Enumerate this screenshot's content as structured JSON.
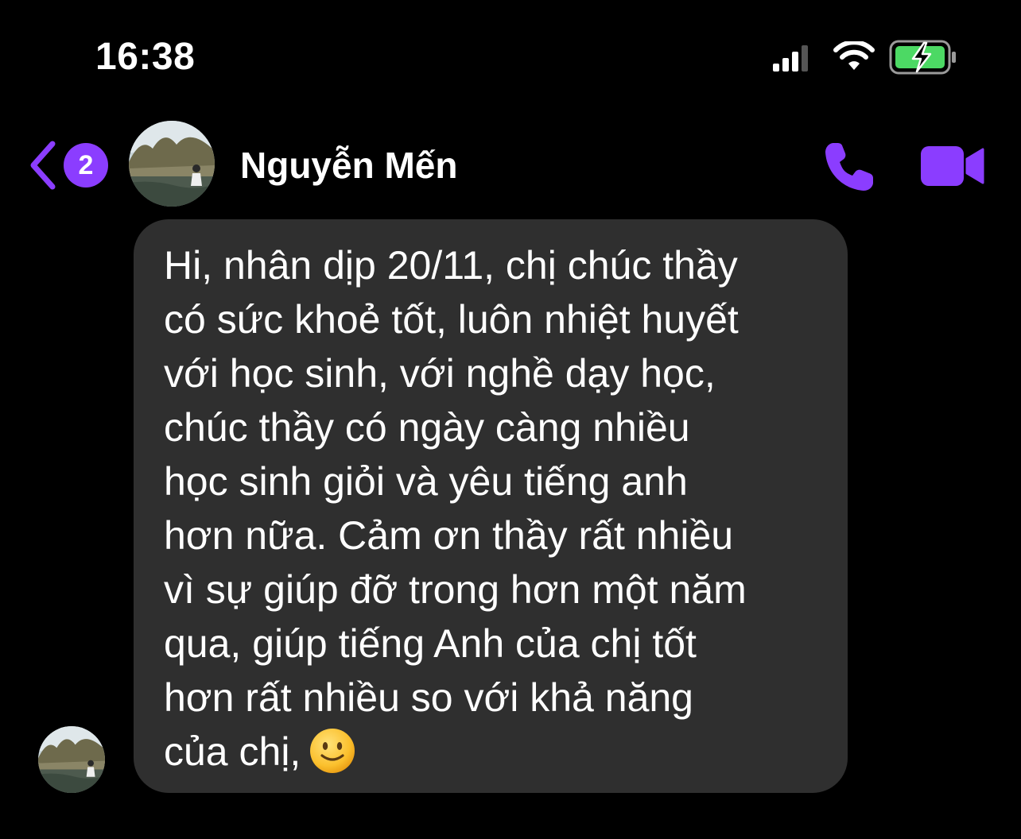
{
  "status_bar": {
    "time": "16:38",
    "signal_icon": "cellular-signal-icon",
    "wifi_icon": "wifi-icon",
    "battery_icon": "battery-charging-icon"
  },
  "header": {
    "back_icon": "chevron-left-icon",
    "back_badge": "2",
    "contact_name": "Nguyễn Mến",
    "call_icon": "phone-icon",
    "video_icon": "video-camera-icon"
  },
  "message": {
    "lines": [
      "Hi, nhân dịp 20/11, chị chúc thầy",
      "có sức khoẻ tốt, luôn nhiệt huyết",
      "với học sinh, với nghề dạy học,",
      "chúc thầy có ngày càng nhiều",
      "học sinh giỏi và yêu tiếng anh",
      "hơn nữa. Cảm ơn thầy rất nhiều",
      "vì sự giúp đỡ trong hơn một năm",
      "qua, giúp tiếng Anh của chị tốt",
      "hơn rất nhiều so với khả năng",
      "của chị,"
    ],
    "emoji_icon": "slightly-smiling-face-icon"
  },
  "colors": {
    "accent": "#8b3dff",
    "background": "#000000",
    "bubble": "#2f2f2f"
  }
}
